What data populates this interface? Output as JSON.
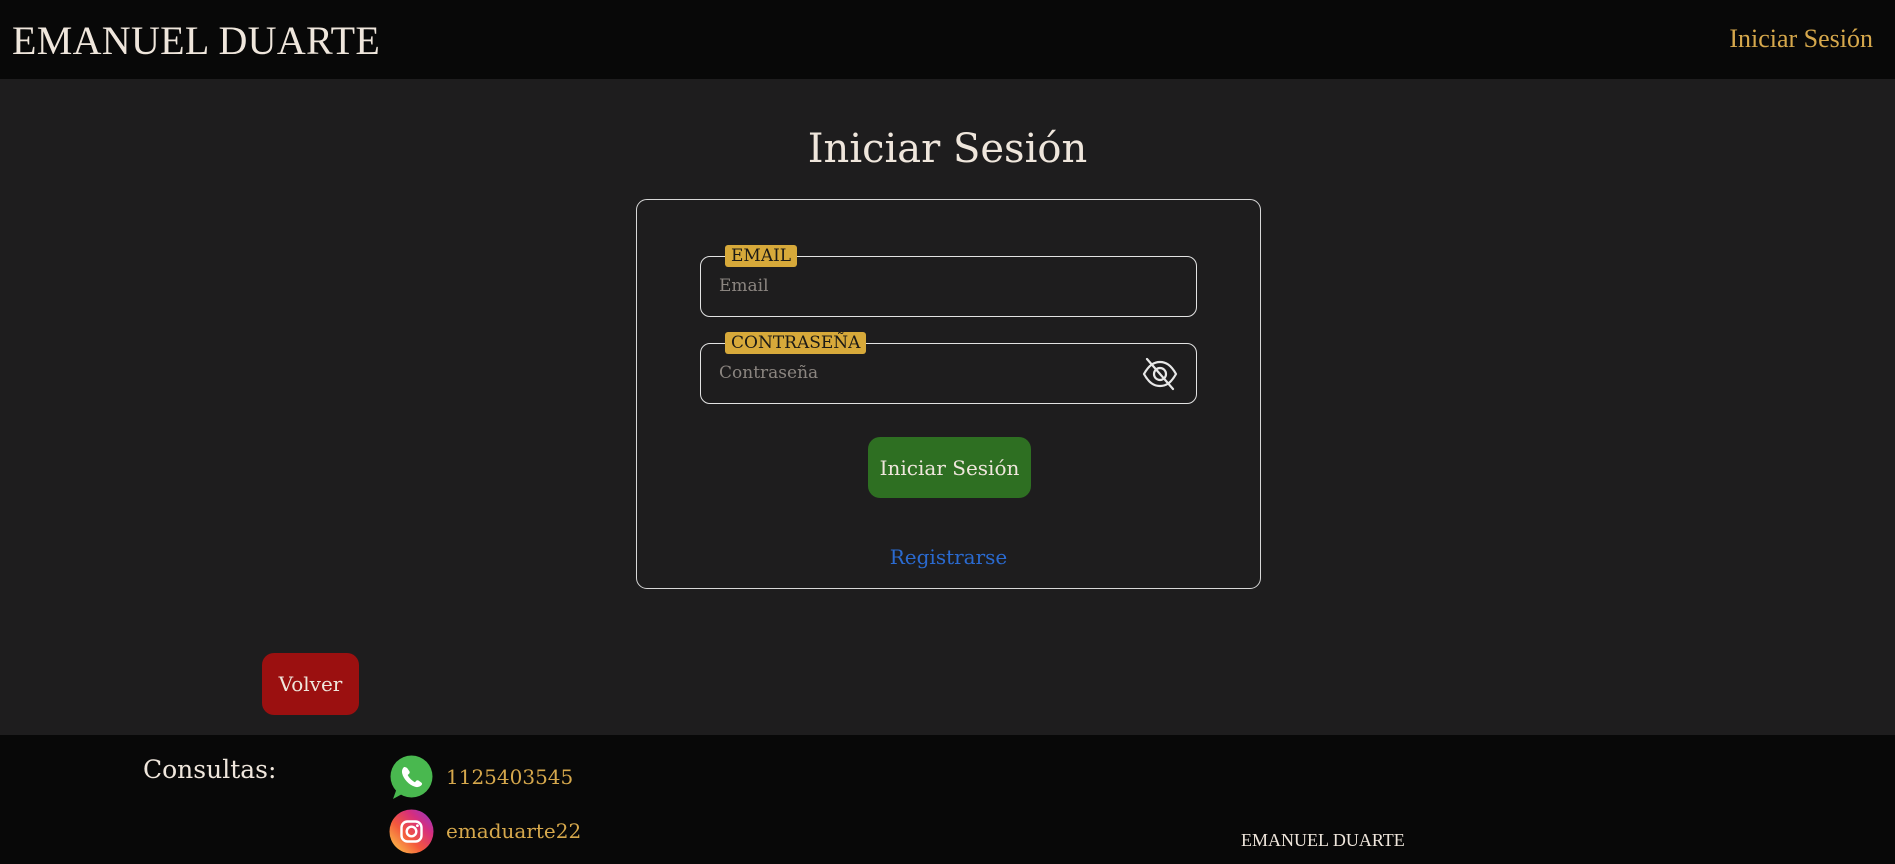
{
  "navbar": {
    "brand": "EMANUEL DUARTE",
    "login_link": "Iniciar Sesión"
  },
  "main": {
    "title": "Iniciar Sesión",
    "form": {
      "email": {
        "label": "EMAIL",
        "placeholder": "Email",
        "value": ""
      },
      "password": {
        "label": "CONTRASEÑA",
        "placeholder": "Contraseña",
        "value": "",
        "toggle_icon": "eye-slash-icon"
      },
      "submit_label": "Iniciar Sesión",
      "register_link": "Registrarse"
    },
    "back_label": "Volver"
  },
  "footer": {
    "consultas_label": "Consultas:",
    "contacts": [
      {
        "icon": "whatsapp-icon",
        "text": "1125403545"
      },
      {
        "icon": "instagram-icon",
        "text": "emaduarte22"
      }
    ],
    "brand": "EMANUEL DUARTE"
  },
  "colors": {
    "background": "#1e1d1e",
    "navbar": "#080808",
    "accent_gold": "#d6a84c",
    "label_gold": "#d7a93a",
    "submit_green": "#2e6f22",
    "back_red": "#9b1010",
    "link_blue": "#2a6ad0"
  }
}
